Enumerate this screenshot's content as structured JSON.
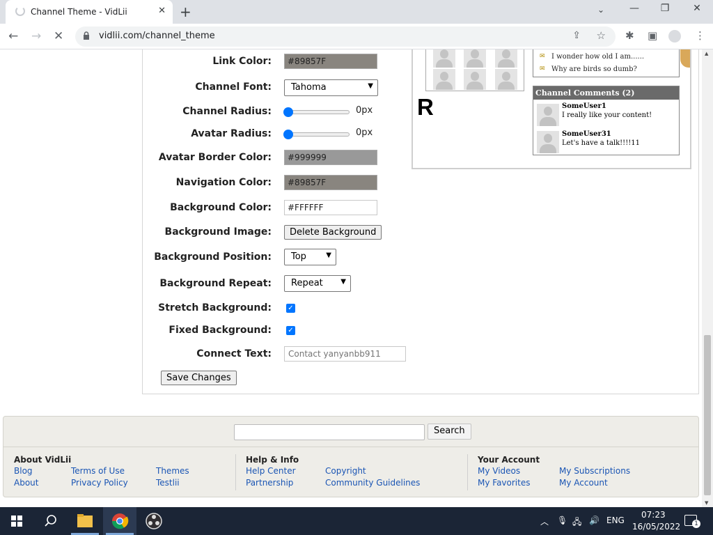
{
  "browser": {
    "tab_title": "Channel Theme - VidLii",
    "url": "vidlii.com/channel_theme"
  },
  "form": {
    "link_color": {
      "label": "Link Color:",
      "value": "#89857F"
    },
    "channel_font": {
      "label": "Channel Font:",
      "value": "Tahoma"
    },
    "channel_radius": {
      "label": "Channel Radius:",
      "value": "0px"
    },
    "avatar_radius": {
      "label": "Avatar Radius:",
      "value": "0px"
    },
    "avatar_border_color": {
      "label": "Avatar Border Color:",
      "value": "#999999"
    },
    "navigation_color": {
      "label": "Navigation Color:",
      "value": "#89857F"
    },
    "background_color": {
      "label": "Background Color:",
      "value": "#FFFFFF"
    },
    "background_image": {
      "label": "Background Image:",
      "button": "Delete Background"
    },
    "background_position": {
      "label": "Background Position:",
      "value": "Top"
    },
    "background_repeat": {
      "label": "Background Repeat:",
      "value": "Repeat"
    },
    "stretch_background": {
      "label": "Stretch Background:",
      "checked": true
    },
    "fixed_background": {
      "label": "Fixed Background:",
      "checked": true
    },
    "connect_text": {
      "label": "Connect Text:",
      "placeholder": "Contact yanyanbb911"
    },
    "save_button": "Save Changes"
  },
  "preview": {
    "big_letter": "R",
    "bulletins": [
      "I wonder how old I am......",
      "Why are birds so dumb?"
    ],
    "comments_header": "Channel Comments (2)",
    "comments": [
      {
        "user": "SomeUser1",
        "text": "I really like your content!"
      },
      {
        "user": "SomeUser31",
        "text": "Let's have a talk!!!!11"
      }
    ]
  },
  "footer": {
    "search_button": "Search",
    "sections": [
      {
        "title": "About VidLii",
        "links": [
          "Blog",
          "About",
          "Terms of Use",
          "Privacy Policy",
          "Themes",
          "Testlii"
        ]
      },
      {
        "title": "Help & Info",
        "links": [
          "Help Center",
          "Partnership",
          "Copyright",
          "Community Guidelines"
        ]
      },
      {
        "title": "Your Account",
        "links": [
          "My Videos",
          "My Favorites",
          "My Subscriptions",
          "My Account"
        ]
      }
    ]
  },
  "taskbar": {
    "language": "ENG",
    "time": "07:23",
    "date": "16/05/2022",
    "notifications": "1"
  },
  "colors": {
    "link_color": "#89857F",
    "avatar_border_color": "#999999",
    "navigation_color": "#89857F",
    "background_color": "#FFFFFF",
    "accent": "#0075ff"
  }
}
